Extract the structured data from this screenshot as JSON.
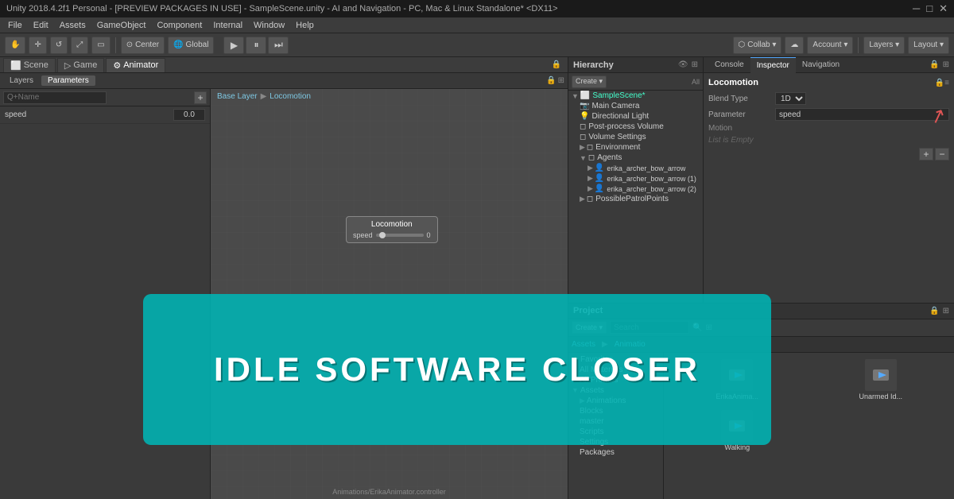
{
  "titleBar": {
    "title": "Unity 2018.4.2f1 Personal - [PREVIEW PACKAGES IN USE] - SampleScene.unity - AI and Navigation - PC, Mac & Linux Standalone* <DX11>",
    "minimize": "─",
    "maximize": "□",
    "close": "✕"
  },
  "menuBar": {
    "items": [
      "File",
      "Edit",
      "Assets",
      "GameObject",
      "Component",
      "Internal",
      "Window",
      "Help"
    ]
  },
  "toolbar": {
    "center_label": "Center",
    "global_label": "Global",
    "collab_label": "Collab ▾",
    "account_label": "Account ▾",
    "layers_label": "Layers ▾",
    "layout_label": "Layout ▾",
    "cloud_icon": "☁"
  },
  "animator": {
    "tabs": [
      "Scene",
      "Game",
      "Animator"
    ],
    "active_tab": "Animator",
    "sub_tabs": [
      "Layers",
      "Parameters"
    ],
    "active_sub": "Parameters",
    "breadcrumb": [
      "Base Layer",
      "Locomotion"
    ],
    "param_search_placeholder": "Q+Name",
    "params": [
      {
        "name": "speed",
        "value": "0.0"
      }
    ],
    "node": {
      "title": "Locomotion",
      "speed_label": "speed",
      "speed_value": "0"
    },
    "status": "Animations/ErikaAnimator.controller"
  },
  "hierarchy": {
    "title": "Hierarchy",
    "search_placeholder": "Q",
    "create_label": "Create ▾",
    "all_label": "All",
    "items": [
      {
        "label": "SampleScene*",
        "indent": 0,
        "expanded": true,
        "starred": true
      },
      {
        "label": "Main Camera",
        "indent": 1
      },
      {
        "label": "Directional Light",
        "indent": 1
      },
      {
        "label": "Post-process Volume",
        "indent": 1
      },
      {
        "label": "Volume Settings",
        "indent": 1
      },
      {
        "label": "Environment",
        "indent": 1,
        "expanded": false
      },
      {
        "label": "Agents",
        "indent": 1,
        "expanded": true
      },
      {
        "label": "erika_archer_bow_arrow",
        "indent": 2
      },
      {
        "label": "erika_archer_bow_arrow (1)",
        "indent": 2
      },
      {
        "label": "erika_archer_bow_arrow (2)",
        "indent": 2
      },
      {
        "label": "PossiblePatrolPoints",
        "indent": 1,
        "expanded": false
      }
    ]
  },
  "inspector": {
    "tabs": [
      "Console",
      "Inspector",
      "Navigation"
    ],
    "active_tab": "Inspector",
    "title": "Locomotion",
    "blend_type_label": "Blend Type",
    "blend_type_value": "1D",
    "parameter_label": "Parameter",
    "parameter_value": "speed",
    "motion_label": "Motion",
    "list_empty": "List is Empty",
    "plus_label": "+",
    "minus_label": "−"
  },
  "project": {
    "title": "Project",
    "create_label": "Create ▾",
    "search_placeholder": "Search",
    "assets_label": "Assets",
    "animation_label": "Animatio",
    "tree": [
      {
        "label": "Favorites",
        "star": true,
        "expanded": true
      },
      {
        "label": "All Materials",
        "indent": 1
      },
      {
        "label": "All Prefabs",
        "indent": 1
      },
      {
        "label": "Assets",
        "expanded": true
      },
      {
        "label": "Animations",
        "indent": 1
      },
      {
        "label": "Blocks",
        "indent": 1
      },
      {
        "label": "master",
        "indent": 1
      },
      {
        "label": "Scripts",
        "indent": 1
      },
      {
        "label": "Settings",
        "indent": 1
      },
      {
        "label": "Packages",
        "indent": 1
      }
    ],
    "assets": [
      {
        "name": "ErikaAnima...",
        "type": "animation"
      },
      {
        "name": "Unarmed Id...",
        "type": "animation"
      },
      {
        "name": "Walking",
        "type": "animation"
      }
    ]
  },
  "overlay": {
    "text": "IDLE SOFTWARE CLOSER"
  }
}
